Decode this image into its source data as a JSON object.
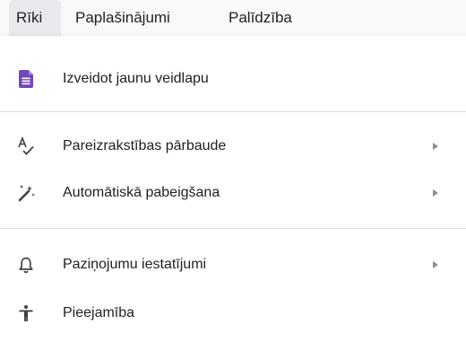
{
  "menubar": {
    "items": [
      {
        "label": "Rīki",
        "active": true
      },
      {
        "label": "Paplašinājumi",
        "active": false
      },
      {
        "label": "Palīdzība",
        "active": false
      }
    ]
  },
  "menu": {
    "items": [
      {
        "label": "Izveidot jaunu veidlapu",
        "icon": "forms-icon",
        "has_submenu": false
      },
      {
        "label": "Pareizrakstības pārbaude",
        "icon": "spellcheck-icon",
        "has_submenu": true
      },
      {
        "label": "Automātiskā pabeigšana",
        "icon": "magic-wand-icon",
        "has_submenu": true
      },
      {
        "label": "Paziņojumu iestatījumi",
        "icon": "bell-icon",
        "has_submenu": true
      },
      {
        "label": "Pieejamība",
        "icon": "accessibility-icon",
        "has_submenu": false
      }
    ]
  },
  "colors": {
    "forms_purple": "#7248b9",
    "icon_gray": "#3c4043",
    "submenu_arrow": "#8a8d91"
  }
}
